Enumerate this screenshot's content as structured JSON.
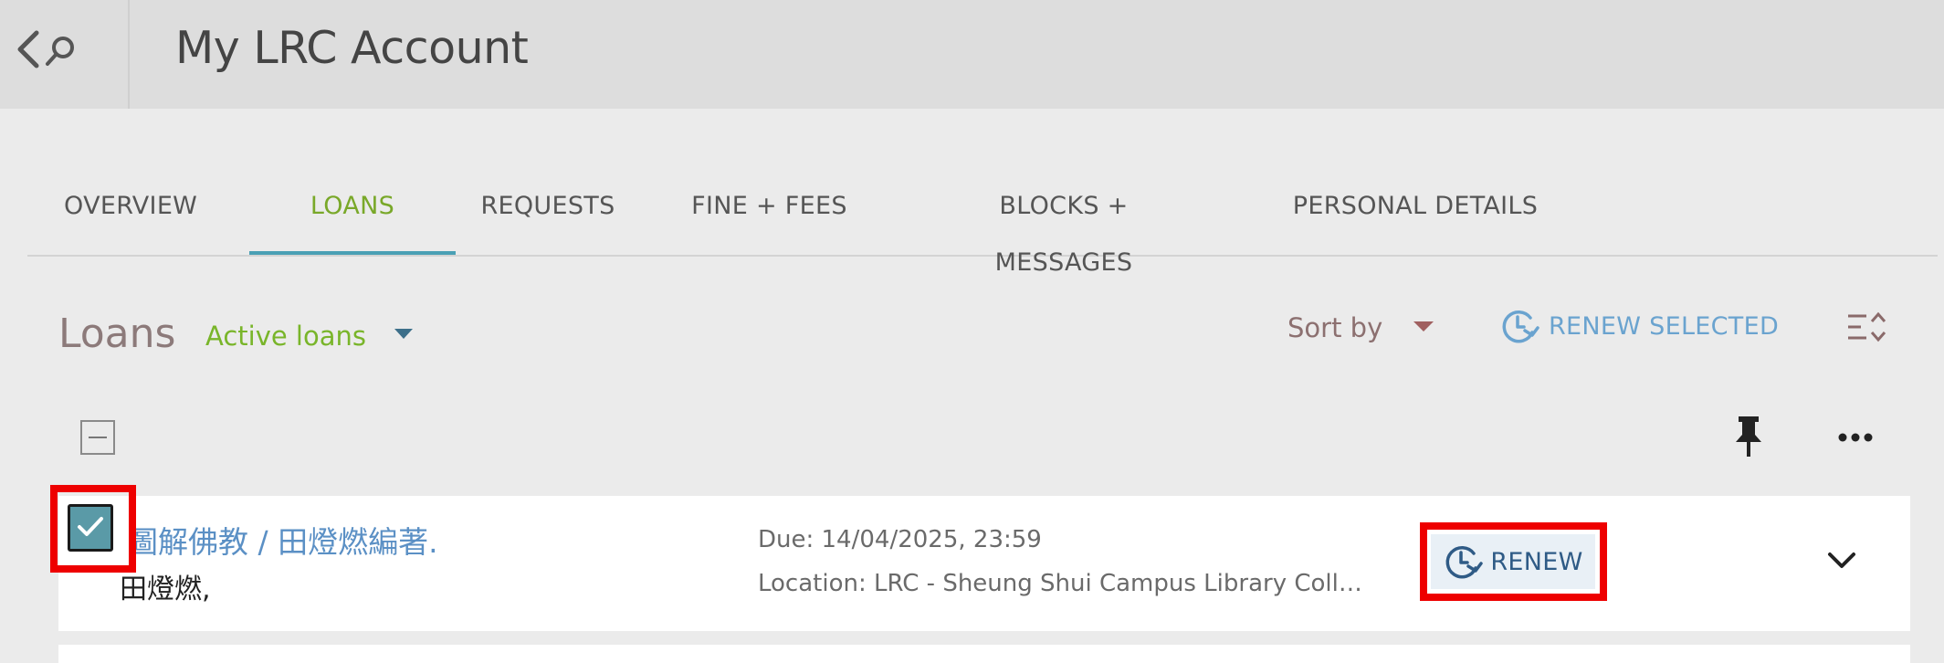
{
  "header": {
    "title": "My LRC Account",
    "back_icon": "chevron-left-icon",
    "search_icon": "search-icon"
  },
  "tabs": [
    {
      "label": "OVERVIEW",
      "active": false
    },
    {
      "label": "LOANS",
      "active": true
    },
    {
      "label": "REQUESTS",
      "active": false
    },
    {
      "label": "FINE + FEES",
      "active": false
    },
    {
      "label": "BLOCKS + MESSAGES",
      "active": false
    },
    {
      "label": "PERSONAL DETAILS",
      "active": false
    }
  ],
  "loans": {
    "title": "Loans",
    "filter": "Active loans",
    "sort_label": "Sort by",
    "renew_selected_label": "RENEW SELECTED",
    "items": [
      {
        "title": "圖解佛教 / 田燈燃編著.",
        "author": "田燈燃,",
        "due": "Due: 14/04/2025, 23:59",
        "location": "Location: LRC - Sheung Shui Campus Library Collection",
        "renew_label": "RENEW",
        "selected": true
      }
    ]
  },
  "colors": {
    "active_tab": "#79a829",
    "tab_underline": "#4aa0b5",
    "link": "#5b90c5",
    "highlight": "#ee0000",
    "checkbox_fill": "#5a9aa7"
  }
}
